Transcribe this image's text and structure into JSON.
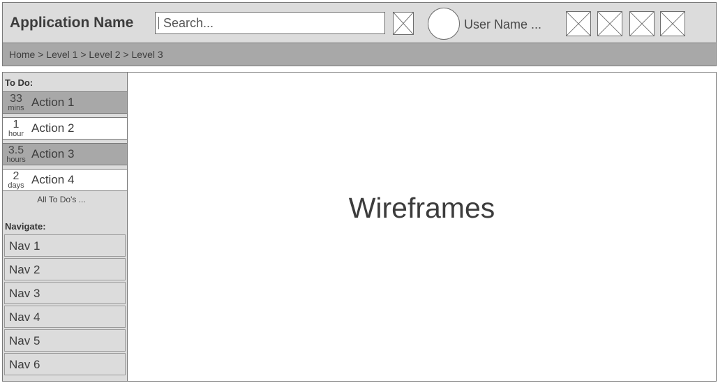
{
  "header": {
    "app_name": "Application Name",
    "search_placeholder": "Search...",
    "user_name": "User Name  ..."
  },
  "breadcrumb": "Home > Level 1 > Level 2 > Level 3",
  "sidebar": {
    "todo_label": "To Do:",
    "todos": [
      {
        "num": "33",
        "unit": "mins",
        "label": "Action 1"
      },
      {
        "num": "1",
        "unit": "hour",
        "label": "Action 2"
      },
      {
        "num": "3.5",
        "unit": "hours",
        "label": "Action 3"
      },
      {
        "num": "2",
        "unit": "days",
        "label": "Action 4"
      }
    ],
    "all_todos": "All To Do's ...",
    "navigate_label": "Navigate:",
    "nav_items": [
      "Nav 1",
      "Nav 2",
      "Nav 3",
      "Nav 4",
      "Nav 5",
      "Nav 6"
    ]
  },
  "main": {
    "title": "Wireframes"
  },
  "icons": {
    "placeholder": "image-placeholder-icon",
    "avatar": "avatar-circle"
  }
}
